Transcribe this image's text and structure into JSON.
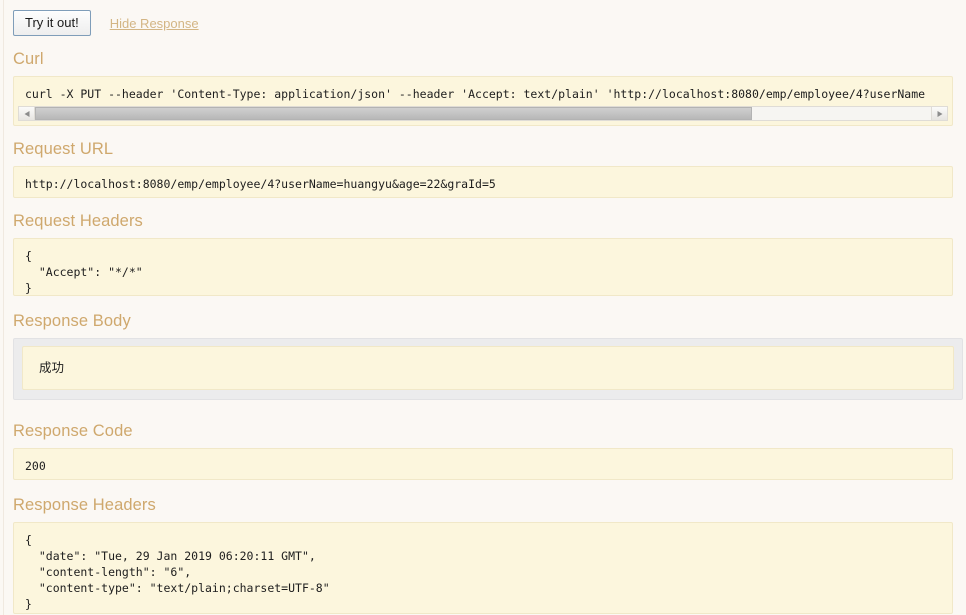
{
  "toolbar": {
    "try_it_out_label": "Try it out!",
    "hide_response_label": "Hide Response"
  },
  "sections": {
    "curl": {
      "title": "Curl",
      "command": "curl -X PUT --header 'Content-Type: application/json' --header 'Accept: text/plain' 'http://localhost:8080/emp/employee/4?userName"
    },
    "request_url": {
      "title": "Request URL",
      "url": "http://localhost:8080/emp/employee/4?userName=huangyu&age=22&graId=5"
    },
    "request_headers": {
      "title": "Request Headers",
      "json": "{\n  \"Accept\": \"*/*\"\n}"
    },
    "response_body": {
      "title": "Response Body",
      "body": "成功"
    },
    "response_code": {
      "title": "Response Code",
      "code": "200"
    },
    "response_headers": {
      "title": "Response Headers",
      "json": "{\n  \"date\": \"Tue, 29 Jan 2019 06:20:11 GMT\",\n  \"content-length\": \"6\",\n  \"content-type\": \"text/plain;charset=UTF-8\"\n}"
    }
  },
  "scrollbar": {
    "left_arrow_icon": "triangle-left-icon",
    "right_arrow_icon": "triangle-right-icon"
  },
  "colors": {
    "page_background": "#fbf8f4",
    "heading": "#cfa86d",
    "code_background": "#fcf6dd",
    "code_border": "#f1e8c8",
    "link": "#d3b584",
    "button_border": "#7f9db9"
  }
}
